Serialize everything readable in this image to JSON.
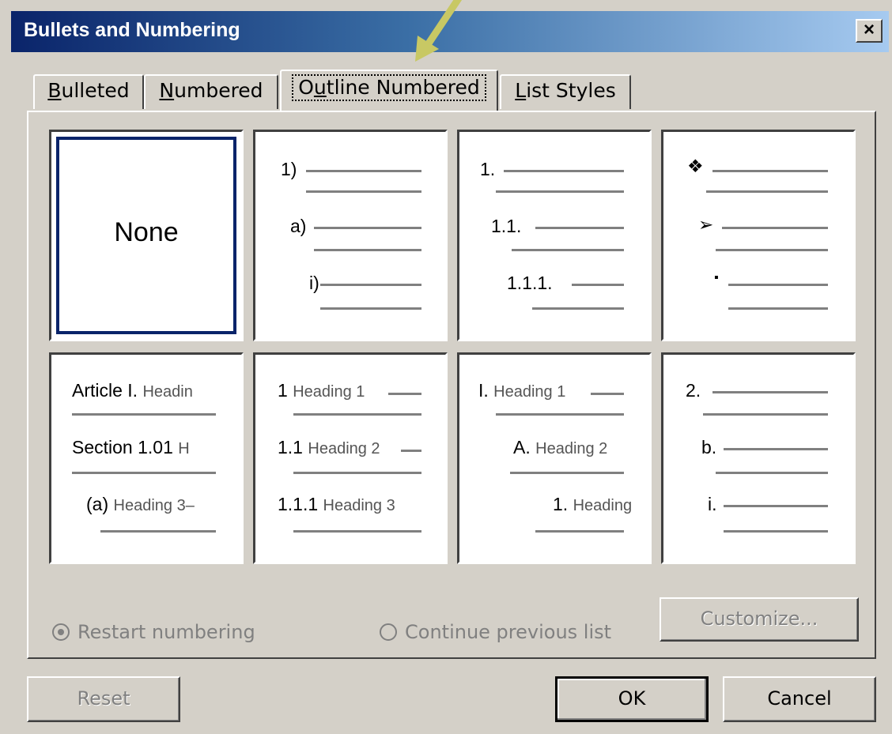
{
  "window": {
    "title": "Bullets and Numbering",
    "close_glyph": "×"
  },
  "tabs": [
    {
      "label_pre": "",
      "label_u": "B",
      "label_post": "ulleted"
    },
    {
      "label_pre": "",
      "label_u": "N",
      "label_post": "umbered"
    },
    {
      "label_pre": "O",
      "label_u": "u",
      "label_post": "tline Numbered"
    },
    {
      "label_pre": "",
      "label_u": "L",
      "label_post": "ist Styles"
    }
  ],
  "active_tab": 2,
  "gallery": {
    "none_label": "None",
    "c1": {
      "r1": "1)",
      "r2": "a)",
      "r3": "i)"
    },
    "c2": {
      "r1": "1.",
      "r2": "1.1.",
      "r3": "1.1.1."
    },
    "c3": {
      "r1": "❖",
      "r2": "➢",
      "r3": "▪"
    },
    "c4": {
      "r1a": "Article I.",
      "r1b": "Headin",
      "r2a": "Section 1.01",
      "r2b": "H",
      "r3a": "(a)",
      "r3b": "Heading 3–"
    },
    "c5": {
      "r1a": "1",
      "r1b": "Heading 1",
      "r2a": "1.1",
      "r2b": "Heading 2",
      "r3a": "1.1.1",
      "r3b": "Heading 3"
    },
    "c6": {
      "r1a": "I.",
      "r1b": "Heading 1",
      "r2a": "A.",
      "r2b": "Heading 2",
      "r3a": "1.",
      "r3b": "Heading"
    },
    "c7": {
      "r1": "2.",
      "r2": "b.",
      "r3": "i."
    }
  },
  "options": {
    "restart": "Restart numbering",
    "continue": "Continue previous list",
    "customize": "Customize..."
  },
  "buttons": {
    "reset": "Reset",
    "ok": "OK",
    "cancel": "Cancel"
  },
  "colors": {
    "title_start": "#0a246a",
    "title_end": "#a6caf0",
    "selection": "#0a246a",
    "arrow": "#c8c864"
  }
}
